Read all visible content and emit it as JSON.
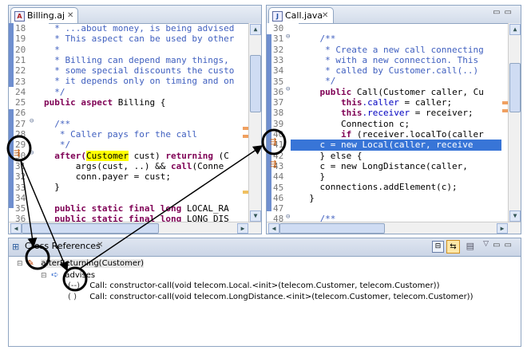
{
  "billing": {
    "tab": "Billing.aj",
    "lines": [
      {
        "n": "18",
        "text": "  * ...about money, is being advised"
      },
      {
        "n": "19",
        "text": "  * This aspect can be used by other"
      },
      {
        "n": "20",
        "text": "  *"
      },
      {
        "n": "21",
        "text": "  * Billing can depend many things,"
      },
      {
        "n": "22",
        "text": "  * some special discounts the custo"
      },
      {
        "n": "23",
        "text": "  * it depends only on timing and on"
      },
      {
        "n": "24",
        "text": "  */"
      },
      {
        "n": "25",
        "kw": "public aspect",
        "rest": " Billing {"
      },
      {
        "n": "26",
        "text": ""
      },
      {
        "n": "27",
        "text": "  /**"
      },
      {
        "n": "28",
        "text": "   * Caller pays for the call"
      },
      {
        "n": "29",
        "text": "   */"
      },
      {
        "n": "30",
        "a": "after(",
        "b": "Customer",
        "c": " cust) ",
        "d": "returning",
        "e": " (C"
      },
      {
        "n": "31",
        "a": "      args(cust, ..) && ",
        "b": "call",
        "c": "(Conne"
      },
      {
        "n": "32",
        "text": "      conn.payer = cust;"
      },
      {
        "n": "33",
        "text": "  }"
      },
      {
        "n": "34",
        "text": ""
      },
      {
        "n": "35",
        "kw": "public static final long",
        "rest": " LOCAL_RA"
      },
      {
        "n": "36",
        "kw": "public static final long",
        "rest": " LONG_DIS"
      }
    ]
  },
  "call": {
    "tab": "Call.java",
    "lines": [
      {
        "n": "30",
        "text": ""
      },
      {
        "n": "31",
        "text": "    /**"
      },
      {
        "n": "32",
        "text": "     * Create a new call connecting"
      },
      {
        "n": "33",
        "text": "     * with a new connection. This"
      },
      {
        "n": "34",
        "text": "     * called by Customer.call(..)"
      },
      {
        "n": "35",
        "text": "     */"
      },
      {
        "n": "36",
        "kw": "public",
        "rest": " Call(Customer caller, Cu"
      },
      {
        "n": "37",
        "kw": "this",
        "fld": ".caller",
        "rest": " = caller;"
      },
      {
        "n": "38",
        "kw": "this",
        "fld": ".receiver",
        "rest": " = receiver;"
      },
      {
        "n": "39",
        "text": "        Connection c;"
      },
      {
        "n": "40",
        "kw": "if",
        "rest": " (receiver.localTo(caller"
      },
      {
        "n": "41",
        "text": "    c = new Local(caller, receive"
      },
      {
        "n": "42",
        "text": "    } else {"
      },
      {
        "n": "43",
        "text": "    c = new LongDistance(caller,"
      },
      {
        "n": "44",
        "text": "    }"
      },
      {
        "n": "45",
        "text": "    connections.addElement(c);"
      },
      {
        "n": "46",
        "text": "  }"
      },
      {
        "n": "47",
        "text": ""
      },
      {
        "n": "48",
        "text": "    /**"
      }
    ]
  },
  "xref": {
    "tab": "Cross References",
    "root": "afterReturning(Customer)",
    "relation": "advises",
    "items": [
      "Call: constructor-call(void telecom.Local.<init>(telecom.Customer, telecom.Customer))",
      "Call: constructor-call(void telecom.LongDistance.<init>(telecom.Customer, telecom.Customer))"
    ]
  },
  "colors": {
    "keyword": "#7f0055",
    "comment": "#3f5fbf",
    "field": "#0000c0",
    "selection": "#3875d7",
    "highlight": "#ffff00"
  }
}
